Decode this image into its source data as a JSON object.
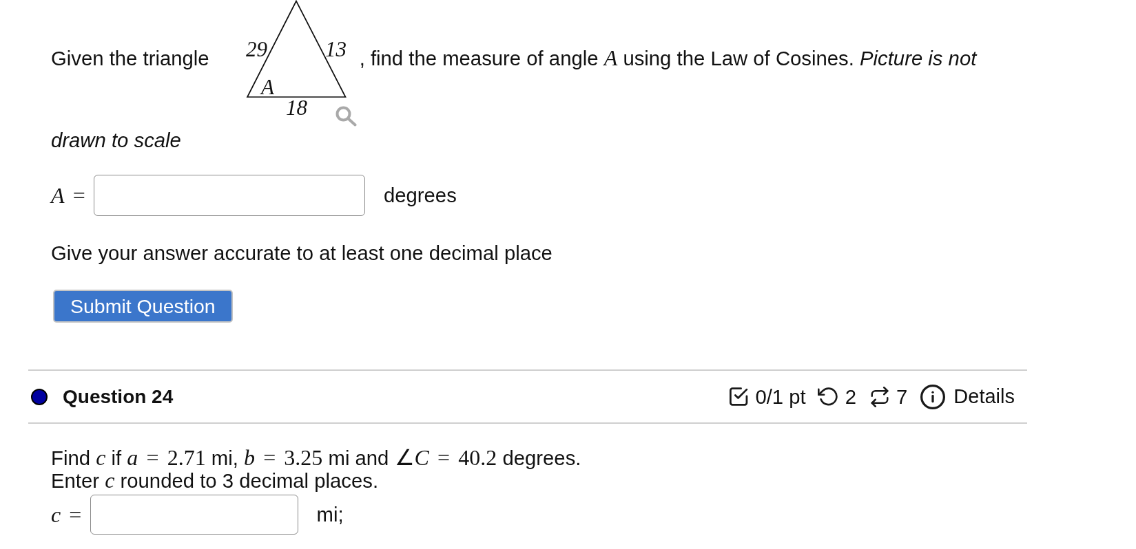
{
  "question_23": {
    "prompt": {
      "lead": "Given the triangle",
      "figure": {
        "left_side": "29",
        "right_side": "13",
        "base": "18",
        "angle": "A"
      },
      "rest": [
        {
          "kind": "text",
          "text": ", find the measure of angle"
        },
        {
          "kind": "math",
          "text": "A"
        },
        {
          "kind": "text",
          "text": "using the Law of Cosines."
        },
        {
          "kind": "note",
          "text": "Picture is not"
        }
      ],
      "rest_continued": "drawn to scale"
    },
    "answer": {
      "label": "A =",
      "unit": "degrees"
    },
    "hint": "Give your answer accurate to at least one decimal place",
    "submit_button": "Submit Question"
  },
  "question_24": {
    "header": {
      "title": "Question 24",
      "score": "0/1 pt",
      "retries": "2",
      "attempts": "7",
      "details": "Details"
    },
    "body": [
      [
        {
          "kind": "text",
          "text": "Find"
        },
        {
          "kind": "math",
          "text": "c"
        },
        {
          "kind": "text",
          "text": "if"
        },
        {
          "kind": "math",
          "text": "a = 2.71"
        },
        {
          "kind": "text",
          "text": "mi,"
        },
        {
          "kind": "math",
          "text": "b = 3.25"
        },
        {
          "kind": "text",
          "text": "mi and"
        },
        {
          "kind": "math",
          "text": "∠C = 40.2"
        },
        {
          "kind": "text",
          "text": "degrees."
        }
      ],
      [
        {
          "kind": "text",
          "text": "Enter"
        },
        {
          "kind": "math",
          "text": "c"
        },
        {
          "kind": "text",
          "text": "rounded to 3 decimal places."
        }
      ]
    ],
    "answer": {
      "label": "c =",
      "unit": "mi;"
    }
  }
}
